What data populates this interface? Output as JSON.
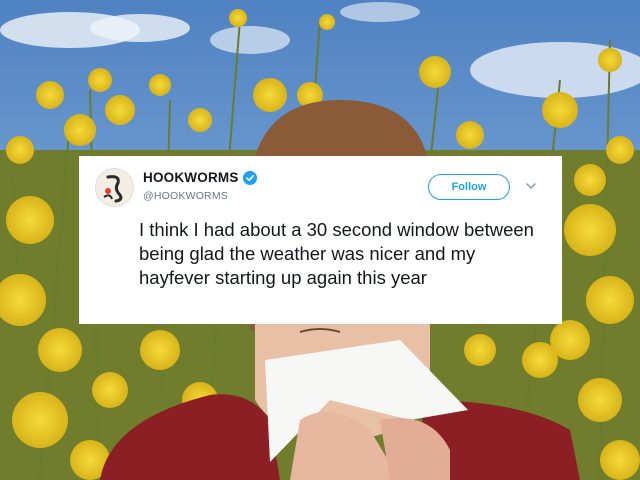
{
  "tweet": {
    "display_name": "HOOKWORMS",
    "handle": "@HOOKWORMS",
    "follow_label": "Follow",
    "text": "I think I had about a 30 second window between being glad the weather was nicer and my hayfever starting up again this year"
  },
  "colors": {
    "accent": "#1da1f2",
    "sky": "#5e8fc8",
    "flowers": "#e7c51d",
    "coat": "#8c1f24"
  },
  "icons": {
    "avatar": "hookworms-avatar-icon",
    "verified": "verified-badge-icon",
    "chevron": "chevron-down-icon"
  }
}
